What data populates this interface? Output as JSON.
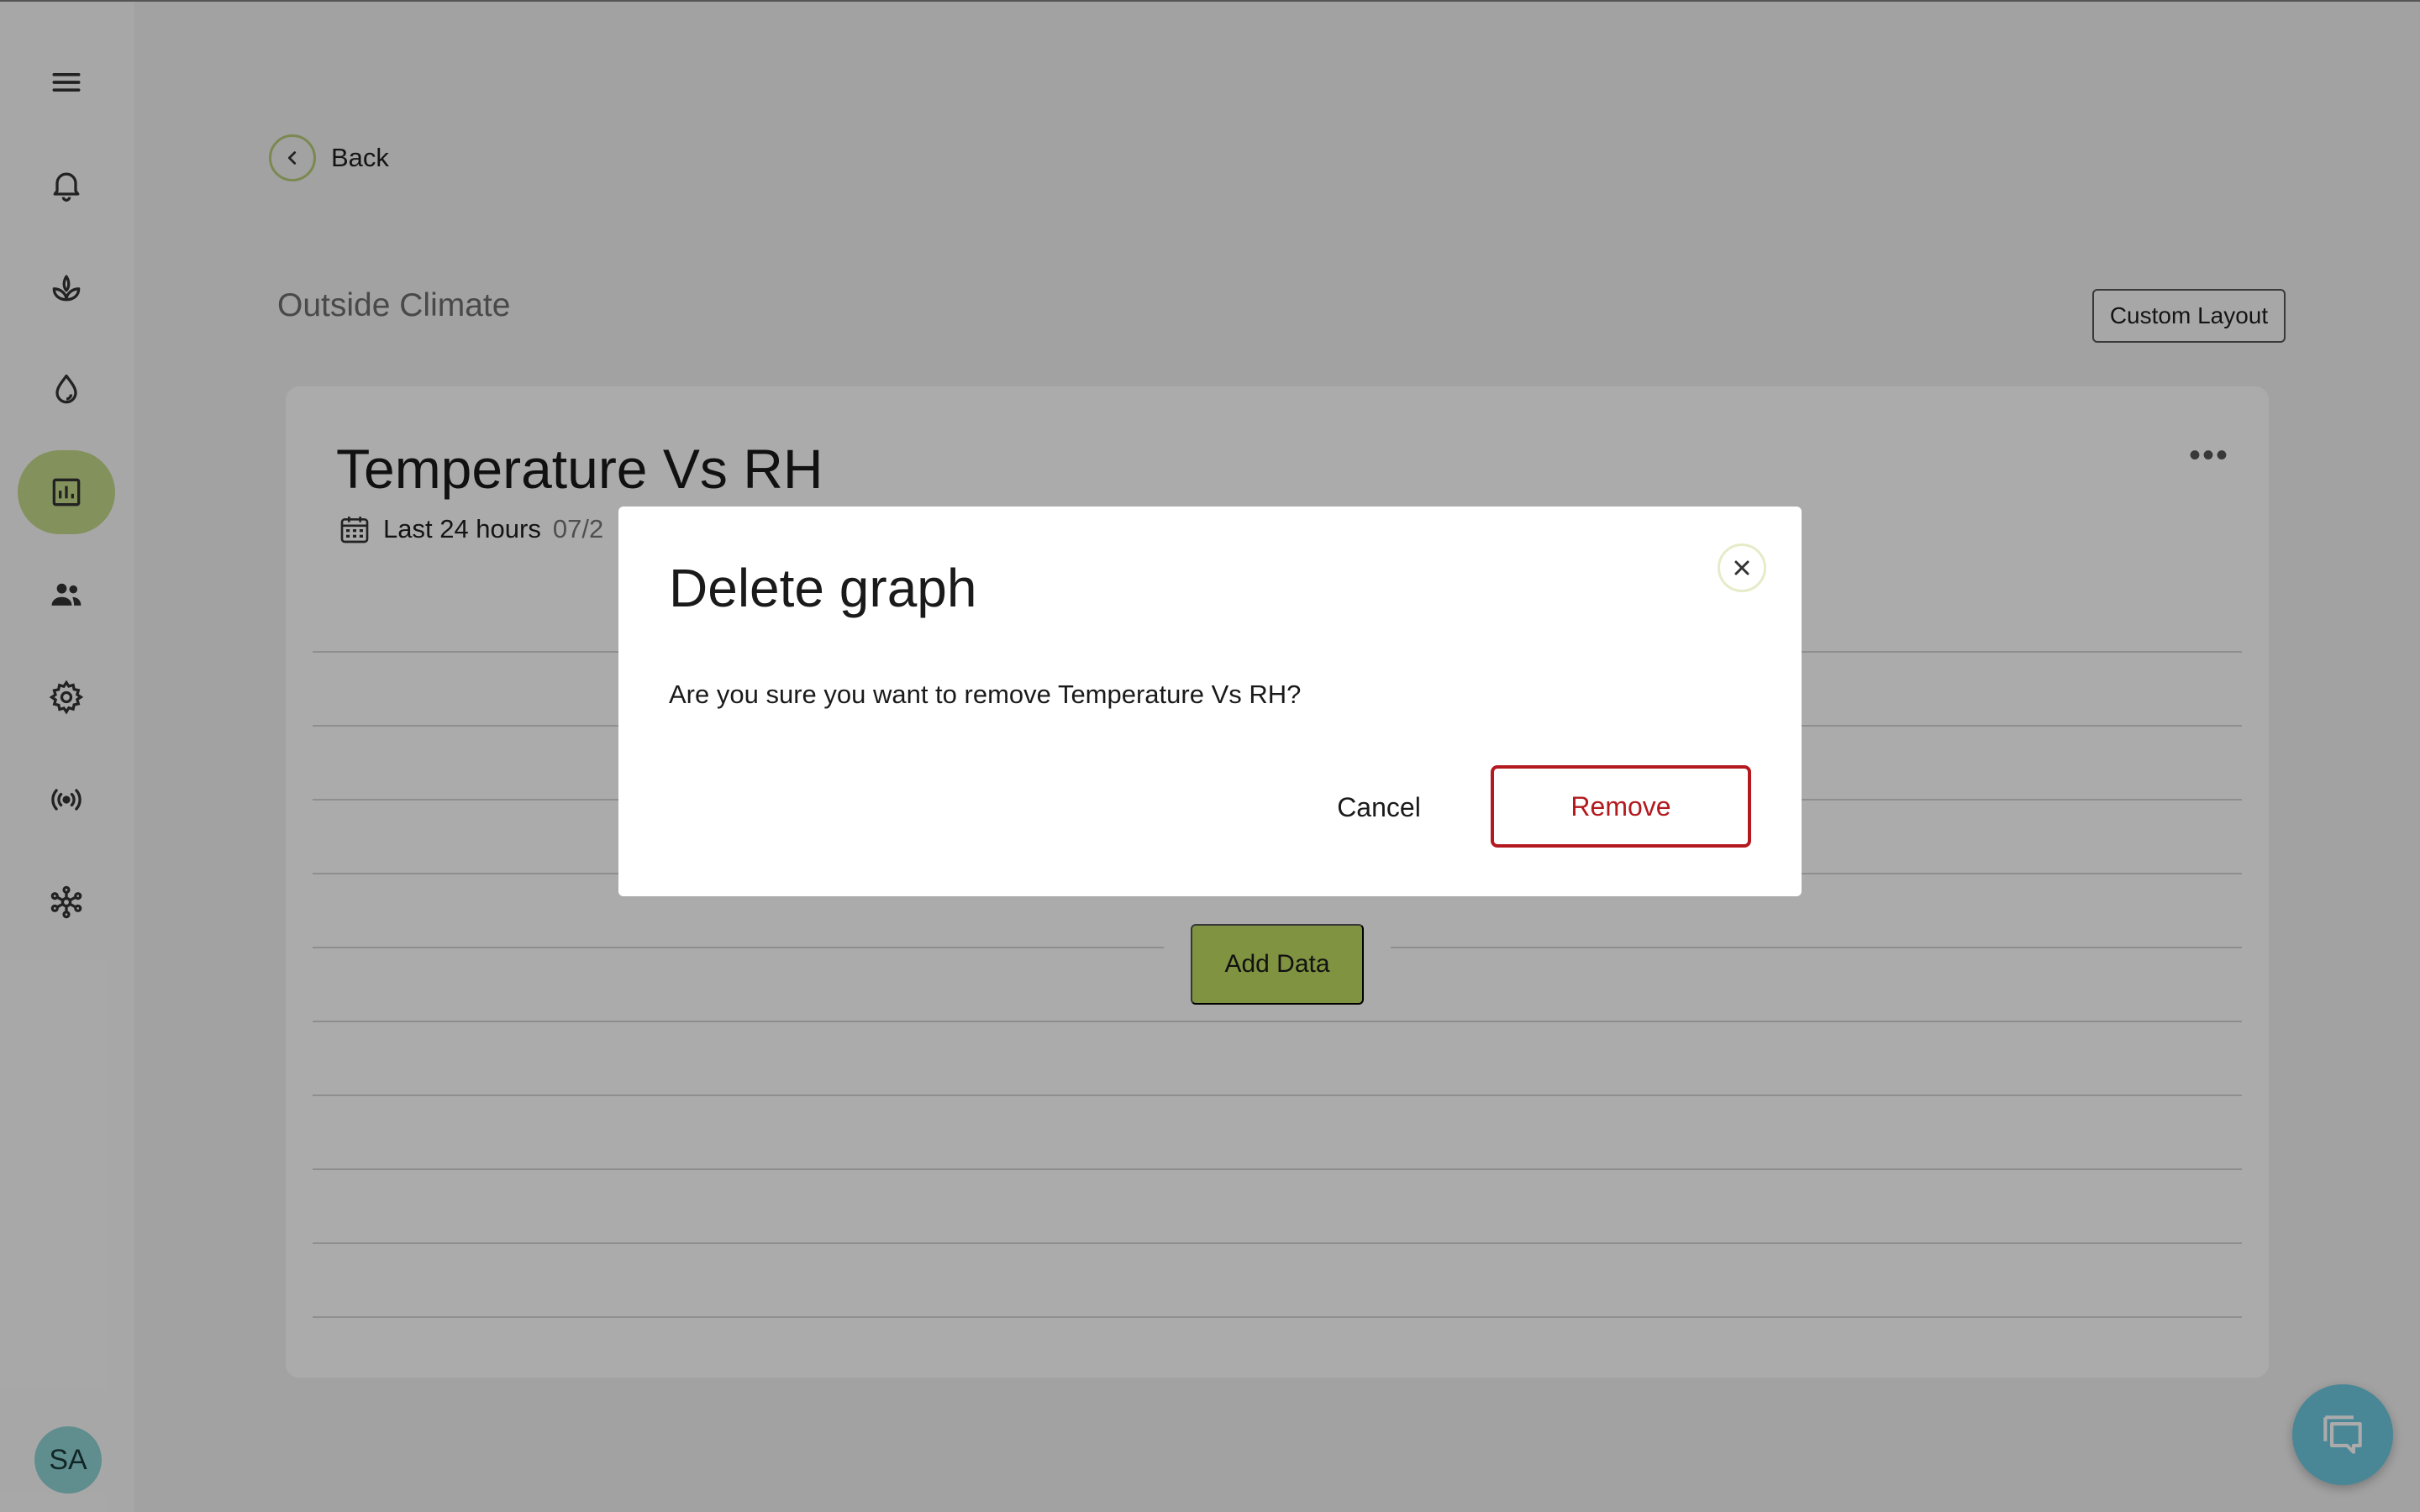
{
  "nav": {
    "items": [
      {
        "icon": "menu-icon"
      },
      {
        "icon": "bell-icon"
      },
      {
        "icon": "plant-icon"
      },
      {
        "icon": "water-drop-icon"
      },
      {
        "icon": "chart-icon",
        "active": true
      },
      {
        "icon": "users-icon"
      },
      {
        "icon": "gear-icon"
      },
      {
        "icon": "broadcast-icon"
      },
      {
        "icon": "network-icon"
      }
    ],
    "avatar_initials": "SA"
  },
  "header": {
    "back_label": "Back",
    "section_title": "Outside Climate",
    "custom_layout_label": "Custom Layout"
  },
  "card": {
    "title": "Temperature Vs RH",
    "more_label": "•••",
    "range_label": "Last 24 hours",
    "range_date": "07/2",
    "add_data_label": "Add Data"
  },
  "modal": {
    "title": "Delete graph",
    "message": "Are you sure you want to remove Temperature Vs RH?",
    "cancel_label": "Cancel",
    "remove_label": "Remove"
  },
  "colors": {
    "accent_green": "#bfdc62",
    "active_nav": "#c3d98a",
    "danger": "#b3191f",
    "chat_button": "#6dc9e0"
  }
}
